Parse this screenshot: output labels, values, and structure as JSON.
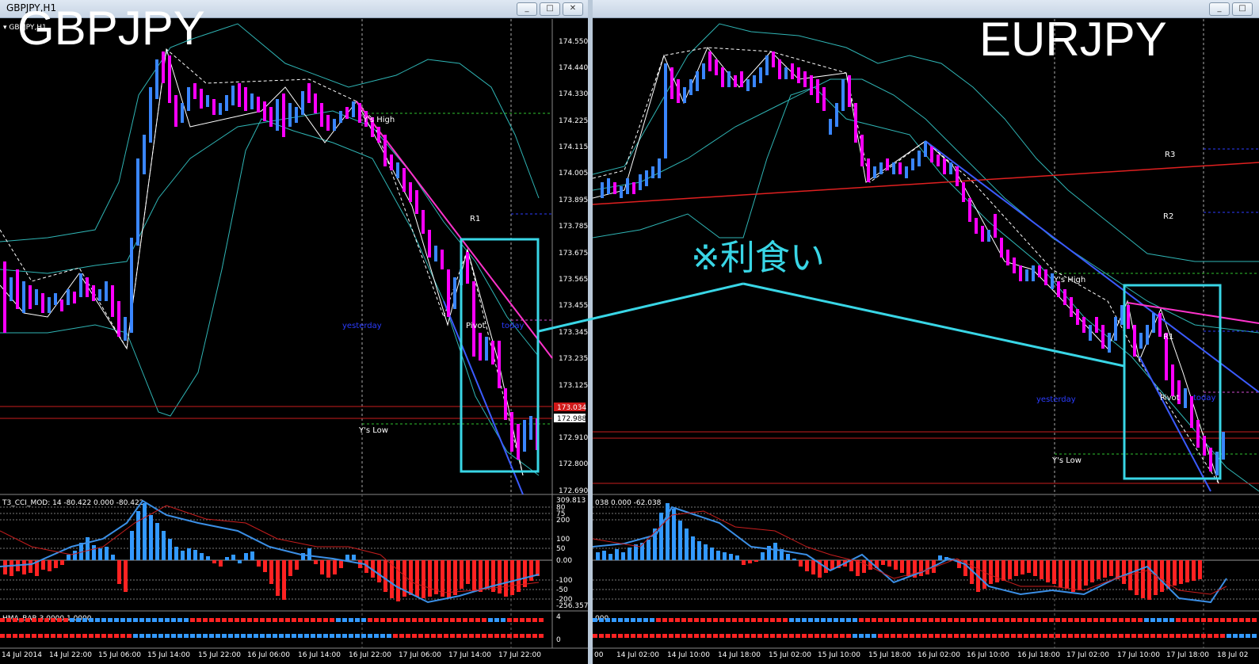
{
  "windows": [
    {
      "title": "GBPJPY,H1",
      "symbol_overlay": "GBPJPY",
      "header_label": "GBPJPY,H1",
      "price_axis": [
        "174.550",
        "174.440",
        "174.330",
        "174.225",
        "174.115",
        "174.005",
        "173.895",
        "173.785",
        "173.675",
        "173.565",
        "173.455",
        "173.345",
        "173.235",
        "173.125",
        "173.015",
        "172.910",
        "172.800",
        "172.690"
      ],
      "price_tags": {
        "bid": "173.034",
        "ask": "172.988"
      },
      "levels": {
        "r1": "R1",
        "pivot": "Pivot",
        "ys_high": "Y's High",
        "ys_low": "Y's Low",
        "yesterday": "yesterday",
        "today": "today"
      },
      "cci_label": "T3_CCI_MOD: 14 -80.422 0.000 -80.422",
      "cci_axis": [
        "309.813",
        "80",
        "75",
        "200",
        "100",
        "50",
        "0.00",
        "-50",
        "-100",
        "-200",
        "-256.357"
      ],
      "hma_label": "HMA_BAR 3.0000 1.0000",
      "hma_axis": [
        "4",
        "0"
      ],
      "time_axis": [
        "14 Jul 2014",
        "14 Jul 22:00",
        "15 Jul 06:00",
        "15 Jul 14:00",
        "15 Jul 22:00",
        "16 Jul 06:00",
        "16 Jul 14:00",
        "16 Jul 22:00",
        "17 Jul 06:00",
        "17 Jul 14:00",
        "17 Jul 22:00"
      ]
    },
    {
      "title": "",
      "symbol_overlay": "EURJPY",
      "levels": {
        "r3": "R3",
        "r2": "R2",
        "r1": "R1",
        "pivot": "Pivot",
        "ys_high": "Y's High",
        "ys_low": "Y's Low",
        "yesterday": "yesterday",
        "today": "today"
      },
      "cci_label": "038 0.000 -62.038",
      "hma_label": "000",
      "time_axis": [
        "00",
        "14 Jul 02:00",
        "14 Jul 10:00",
        "14 Jul 18:00",
        "15 Jul 02:00",
        "15 Jul 10:00",
        "15 Jul 18:00",
        "16 Jul 02:00",
        "16 Jul 10:00",
        "16 Jul 18:00",
        "17 Jul 02:00",
        "17 Jul 10:00",
        "17 Jul 18:00",
        "18 Jul 02"
      ]
    }
  ],
  "annotation": {
    "text": "※利食い"
  },
  "window_buttons": {
    "minimize": "_",
    "restore": "□",
    "close": "✕"
  },
  "colors": {
    "bull": "#3a86ff",
    "bear": "#ff00ff",
    "band": "#2fb5b5",
    "highlight": "#39d6e6",
    "magenta_line": "#ff33cc",
    "blue_line": "#3b5bff",
    "red_line": "#e02020",
    "cci_pos": "#3399ff",
    "cci_neg": "#ff2222"
  }
}
